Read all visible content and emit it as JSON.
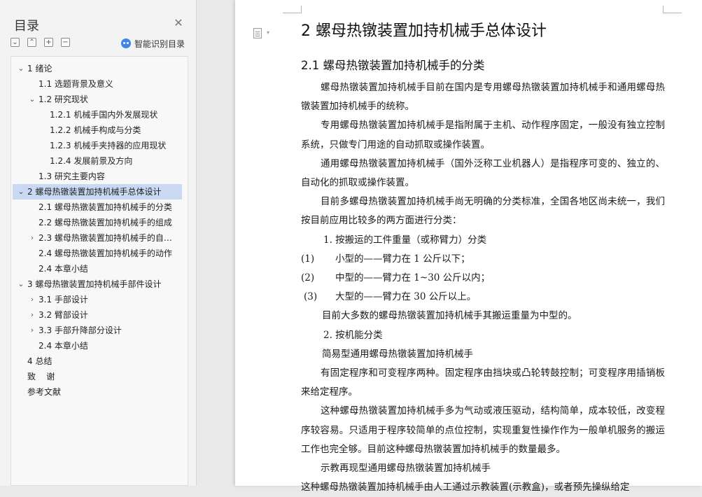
{
  "nav": {
    "title": "目录",
    "close_icon": "close-icon",
    "tools": [
      "collapse-all-icon",
      "expand-all-icon",
      "add-heading-icon",
      "remove-heading-icon"
    ],
    "tool_glyphs": [
      "⌄",
      "⌃",
      "+",
      "−"
    ],
    "smart_toc_label": "智能识别目录",
    "active_color": "#c9d9f4",
    "toc": [
      {
        "label": "1 绪论",
        "chev": "⌄"
      },
      {
        "label": "1.1 选题背景及意义",
        "chev": ""
      },
      {
        "label": "1.2 研究现状",
        "chev": "⌄"
      },
      {
        "label": "1.2.1 机械手国内外发展现状",
        "chev": ""
      },
      {
        "label": "1.2.2 机械手构成与分类",
        "chev": ""
      },
      {
        "label": "1.2.3 机械手夹持器的应用现状",
        "chev": ""
      },
      {
        "label": "1.2.4 发展前景及方向",
        "chev": ""
      },
      {
        "label": "1.3 研究主要内容",
        "chev": ""
      },
      {
        "label": "2 螺母热镦装置加持机械手总体设计",
        "chev": "⌄"
      },
      {
        "label": "2.1 螺母热镦装置加持机械手的分类",
        "chev": ""
      },
      {
        "label": "2.2 螺母热镦装置加持机械手的组成",
        "chev": ""
      },
      {
        "label": "2.3 螺母热镦装置加持机械手的自由度",
        "chev": "›"
      },
      {
        "label": "2.4 螺母热镦装置加持机械手的动作",
        "chev": ""
      },
      {
        "label": "2.4 本章小结",
        "chev": ""
      },
      {
        "label": "3 螺母热镦装置加持机械手部件设计",
        "chev": "⌄"
      },
      {
        "label": "3.1 手部设计",
        "chev": "›"
      },
      {
        "label": "3.2 臂部设计",
        "chev": "›"
      },
      {
        "label": "3.3 手部升降部分设计",
        "chev": "›"
      },
      {
        "label": "2.4  本章小结",
        "chev": ""
      },
      {
        "label": "4 总结",
        "chev": ""
      },
      {
        "label": "致    谢",
        "chev": ""
      },
      {
        "label": "参考文献",
        "chev": ""
      }
    ]
  },
  "doc": {
    "h1": "2 螺母热镦装置加持机械手总体设计",
    "h2": "2.1 螺母热镦装置加持机械手的分类",
    "paragraphs": [
      {
        "text": "螺母热镦装置加持机械手目前在国内是专用螺母热镦装置加持机械手和通用螺母热镦装置加持机械手的统称。"
      },
      {
        "text": "专用螺母热镦装置加持机械手是指附属于主机、动作程序固定，一般没有独立控制系统，只做专门用途的自动抓取或操作装置。"
      },
      {
        "text": "通用螺母热镦装置加持机械手（国外泛称工业机器人）是指程序可变的、独立的、自动化的抓取或操作装置。"
      },
      {
        "text": "目前多螺母热镦装置加持机械手尚无明确的分类标准，全国各地区尚未统一，我们按目前应用比较多的两方面进行分类："
      },
      {
        "text": "1. 按搬运的工件重量（或称臂力）分类"
      },
      {
        "num": "(1)",
        "text": "小型的——臂力在 1 公斤以下；"
      },
      {
        "num": "(2)",
        "text": "中型的——臂力在 1~30 公斤以内；"
      },
      {
        "num": " (3)",
        "text": "大型的——臂力在 30 公斤以上。"
      },
      {
        "text": "目前大多数的螺母热镦装置加持机械手其搬运重量为中型的。"
      },
      {
        "text": "2. 按机能分类"
      },
      {
        "text": "简易型通用螺母热镦装置加持机械手"
      },
      {
        "text": "有固定程序和可变程序两种。固定程序由挡块或凸轮转鼓控制；可变程序用插销板来给定程序。"
      },
      {
        "text": "这种螺母热镦装置加持机械手多为气动或液压驱动，结构简单，成本较低，改变程序较容易。只适用于程序较简单的点位控制，实现重复性操作作为一般单机服务的搬运工作也完全够。目前这种螺母热镦装置加持机械手的数量最多。"
      },
      {
        "text": "示教再现型通用螺母热镦装置加持机械手"
      },
      {
        "text": "这种螺母热镦装置加持机械手由人工通过示教装置(示教盒)，或者预先操纵给定"
      }
    ]
  }
}
